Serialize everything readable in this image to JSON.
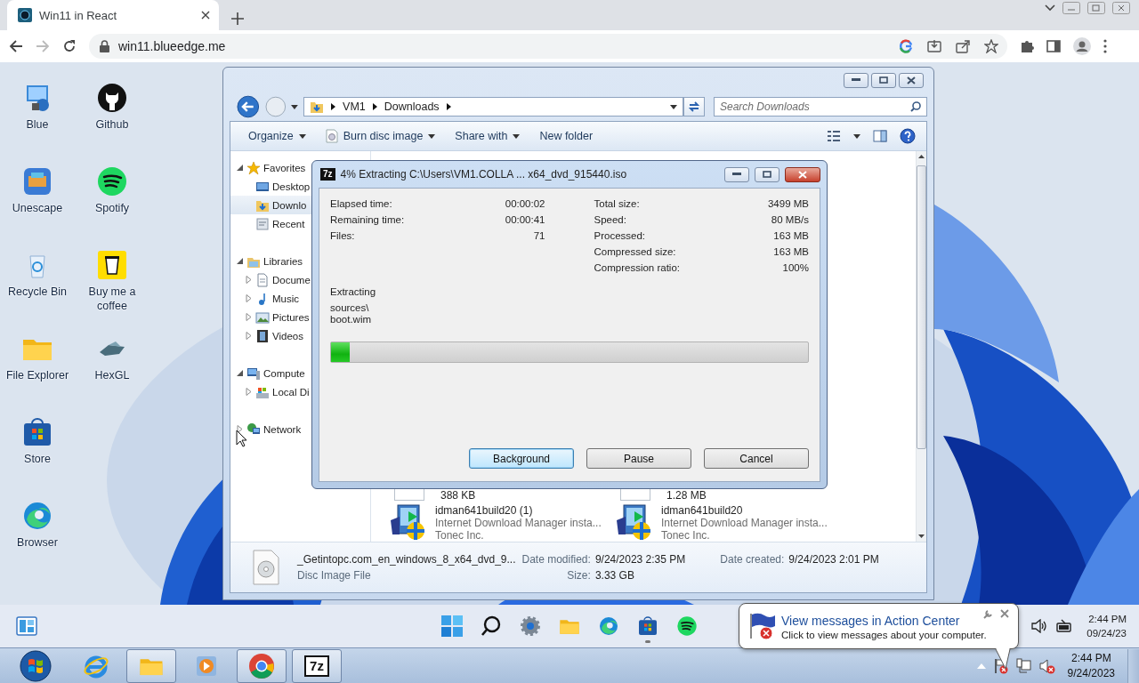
{
  "browser": {
    "tabs": [
      {
        "title": "Win11 in React",
        "selected": true
      }
    ],
    "url": "win11.blueedge.me"
  },
  "desktop_icons": [
    {
      "label": "Blue",
      "kind": "blue"
    },
    {
      "label": "Unescape",
      "kind": "unescape"
    },
    {
      "label": "Recycle Bin",
      "kind": "recycle"
    },
    {
      "label": "File Explorer",
      "kind": "folder"
    },
    {
      "label": "Store",
      "kind": "store"
    },
    {
      "label": "Browser",
      "kind": "edge"
    },
    {
      "label": "Github",
      "kind": "github"
    },
    {
      "label": "Spotify",
      "kind": "spotify"
    },
    {
      "label": "Buy me a coffee",
      "kind": "coffee"
    },
    {
      "label": "HexGL",
      "kind": "hexgl"
    }
  ],
  "explorer": {
    "breadcrumb": [
      "VM1",
      "Downloads"
    ],
    "search": {
      "placeholder": "Search Downloads"
    },
    "toolbar": [
      {
        "label": "Organize",
        "kind": "menu"
      },
      {
        "label": "Burn disc image",
        "kind": "disc"
      },
      {
        "label": "Share with",
        "kind": "menu"
      },
      {
        "label": "New folder",
        "kind": "plain"
      }
    ],
    "nav": [
      {
        "label": "Favorites",
        "kind": "star",
        "expanded": true,
        "selected": false,
        "children": [
          {
            "label": "Desktop",
            "kind": "desktop",
            "selected": false
          },
          {
            "label": "Downlo",
            "kind": "downloads",
            "selected": true
          },
          {
            "label": "Recent",
            "kind": "recent",
            "selected": false
          }
        ]
      },
      {
        "label": "Libraries",
        "kind": "libraries",
        "expanded": true,
        "selected": false,
        "children": [
          {
            "label": "Docume",
            "kind": "documents",
            "expanded": false,
            "selected": false
          },
          {
            "label": "Music",
            "kind": "music",
            "expanded": false,
            "selected": false
          },
          {
            "label": "Pictures",
            "kind": "pictures",
            "expanded": false,
            "selected": false
          },
          {
            "label": "Videos",
            "kind": "videos",
            "expanded": false,
            "selected": false
          }
        ]
      },
      {
        "label": "Compute",
        "kind": "computer",
        "expanded": true,
        "selected": false,
        "children": [
          {
            "label": "Local Di",
            "kind": "drive",
            "expanded": false,
            "selected": false
          }
        ]
      },
      {
        "label": "Network",
        "kind": "network",
        "expanded": false,
        "selected": false
      }
    ],
    "files": [
      {
        "kind": "stub",
        "lines": [
          "388 KB"
        ]
      },
      {
        "kind": "stub",
        "lines": [
          "1.28 MB"
        ]
      },
      {
        "kind": "installer",
        "name": "idman641build20 (1)",
        "lines": [
          "Internet Download Manager insta...",
          "Tonec Inc."
        ]
      },
      {
        "kind": "installer",
        "name": "idman641build20",
        "lines": [
          "Internet Download Manager insta...",
          "Tonec Inc."
        ]
      }
    ],
    "details": {
      "name": "_Getintopc.com_en_windows_8_x64_dvd_9...",
      "type": "Disc Image File",
      "fields": [
        {
          "label": "Date modified:",
          "value": "9/24/2023 2:35 PM"
        },
        {
          "label": "Date created:",
          "value": "9/24/2023 2:01 PM"
        },
        {
          "label": "Size:",
          "value": "3.33 GB"
        }
      ]
    }
  },
  "dialog": {
    "logo": "7z",
    "title": "4% Extracting C:\\Users\\VM1.COLLA ... x64_dvd_915440.iso",
    "stats_left": [
      {
        "label": "Elapsed time:",
        "value": "00:00:02"
      },
      {
        "label": "Remaining time:",
        "value": "00:00:41"
      },
      {
        "label": "Files:",
        "value": "71"
      }
    ],
    "stats_right": [
      {
        "label": "Total size:",
        "value": "3499 MB"
      },
      {
        "label": "Speed:",
        "value": "80 MB/s"
      },
      {
        "label": "Processed:",
        "value": "163 MB"
      },
      {
        "label": "Compressed size:",
        "value": "163 MB"
      },
      {
        "label": "Compression ratio:",
        "value": "100%"
      }
    ],
    "status": "Extracting",
    "path_lines": [
      "sources\\",
      "boot.wim"
    ],
    "progress": {
      "level": 0.04
    },
    "buttons": [
      {
        "label": "Background",
        "focused": true
      },
      {
        "label": "Pause",
        "focused": false
      },
      {
        "label": "Cancel",
        "focused": false
      }
    ]
  },
  "win11_taskbar": {
    "apps": [
      {
        "kind": "start",
        "running": false
      },
      {
        "kind": "search",
        "running": false
      },
      {
        "kind": "settings",
        "running": false
      },
      {
        "kind": "folder",
        "running": false
      },
      {
        "kind": "edge",
        "running": false
      },
      {
        "kind": "store",
        "running": true
      },
      {
        "kind": "spotify",
        "running": false
      }
    ],
    "time": "2:44 PM",
    "date": "09/24/23"
  },
  "win7_taskbar": {
    "apps": [
      {
        "kind": "ie",
        "running": false
      },
      {
        "kind": "explorer",
        "running": true
      },
      {
        "kind": "media",
        "running": false
      },
      {
        "kind": "chrome",
        "running": true
      },
      {
        "kind": "sevenzip",
        "running": true,
        "logo": "7z"
      }
    ],
    "time": "2:44 PM",
    "date": "9/24/2023"
  },
  "balloon": {
    "title": "View messages in Action Center",
    "text": "Click to view messages about your computer."
  }
}
